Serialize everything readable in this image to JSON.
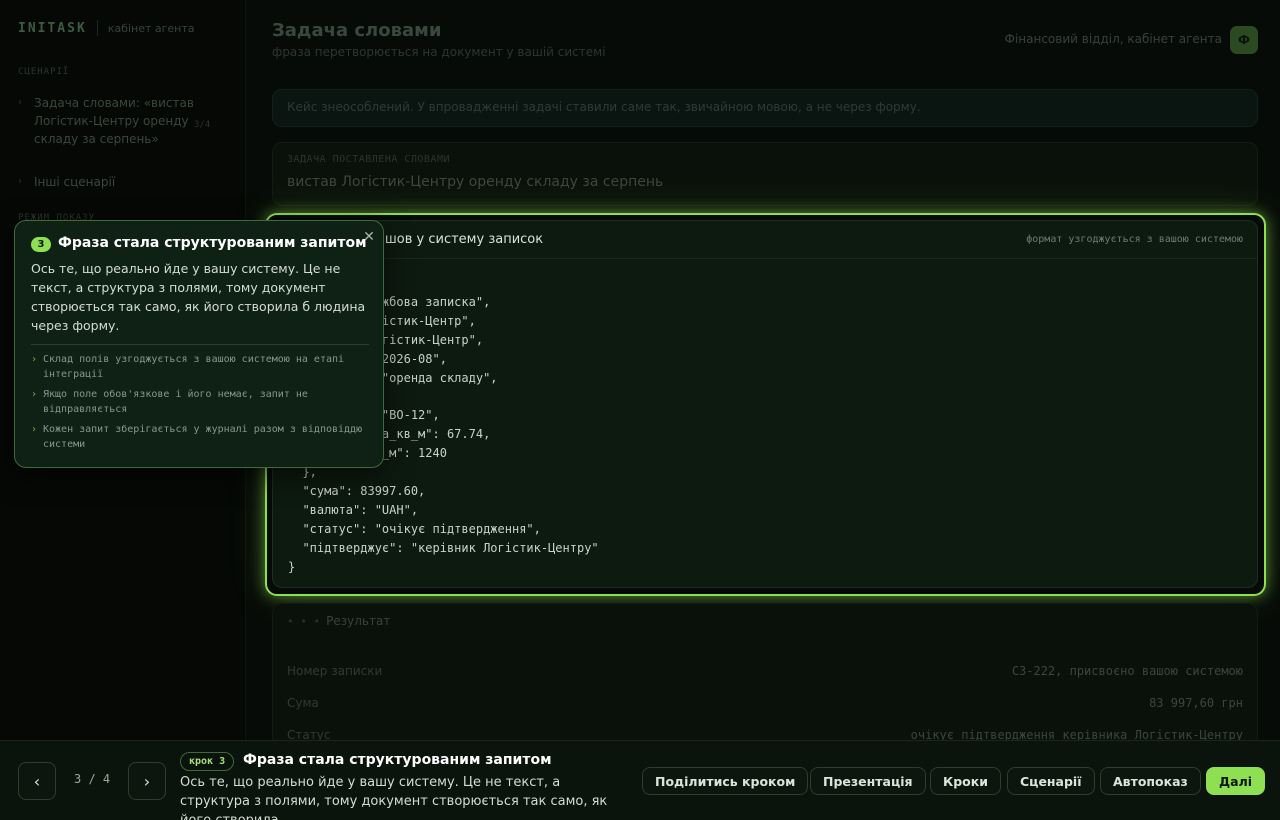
{
  "sidebar": {
    "logo": "INITASK",
    "subtitle": "кабінет агента",
    "section_label": "СЦЕНАРІЇ",
    "items": [
      {
        "label": "Задача словами: «вистав Логістик-Центру оренду складу за серпень»",
        "count": "3/4"
      },
      {
        "label": "Інші сценарії"
      }
    ],
    "section2_label": "РЕЖИМ ПОКАЗУ"
  },
  "header": {
    "title": "Задача словами",
    "subtitle": "фраза перетворюється на документ у вашій системі",
    "crumb": "Фінансовий відділ, кабінет агента",
    "avatar_letter": "Ф"
  },
  "notice": "Кейс знеособлений. У впровадженні задачі ставили саме так, звичайною мовою, а не через форму.",
  "task": {
    "label": "ЗАДАЧА ПОСТАВЛЕНА СЛОВАМИ",
    "value": "вистав Логістик-Центру оренду складу за серпень"
  },
  "request": {
    "title": "Запит, який пішов у систему записок",
    "note": "формат узгоджується з вашою системою",
    "code": "{\n  \"тип\": \"службова записка\",\n  \"від\": \"Логістик-Центр\",\n  \"кому\": \"Логістик-Центр\",\n  \"період\": \"2026-08\",\n  \"предмет\": \"оренда складу\",\n  \"об'єкт\": {\n    \"склад\": \"ВО-12\",\n    \"ставка_за_кв_м\": 67.74,\n    \"площа_кв_м\": 1240\n  },\n  \"сума\": 83997.60,\n  \"валюта\": \"UAH\",\n  \"статус\": \"очікує підтвердження\",\n  \"підтверджує\": \"керівник Логістик-Центру\"\n}"
  },
  "result": {
    "title": "Результат",
    "rows": [
      {
        "key": "Номер записки",
        "value": "СЗ-222, присвоєно вашою системою"
      },
      {
        "key": "Сума",
        "value": "83 997,60 грн"
      },
      {
        "key": "Статус",
        "value": "очікує підтвердження керівника Логістик-Центру"
      }
    ]
  },
  "popover": {
    "step": "3",
    "title": "Фраза стала структурованим запитом",
    "body": "Ось те, що реально йде у вашу систему. Це не текст, а структура з полями, тому документ створюється так само, як його створила б людина через форму.",
    "bullets": [
      "Склад полів узгоджується з вашою системою на етапі інтеграції",
      "Якщо поле обов'язкове і його немає, запит не відправляється",
      "Кожен запит зберігається у журналі разом з відповіддю системи"
    ]
  },
  "bottom_bar": {
    "prev": "‹",
    "next": "›",
    "counter": "3 / 4",
    "step_badge": "крок 3",
    "step_title": "Фраза стала структурованим запитом",
    "step_desc": "Ось те, що реально йде у вашу систему. Це не текст, а структура з полями, тому документ створюється так само, як його створила ...",
    "buttons": {
      "share": "Поділитись кроком",
      "presentation": "Презентація",
      "steps": "Кроки",
      "scenarios": "Сценарії",
      "autoplay": "Автопоказ",
      "next": "Далі"
    }
  },
  "colors": {
    "accent": "#8ee052",
    "background": "#070b08",
    "popover_bg": "#0f2114"
  }
}
